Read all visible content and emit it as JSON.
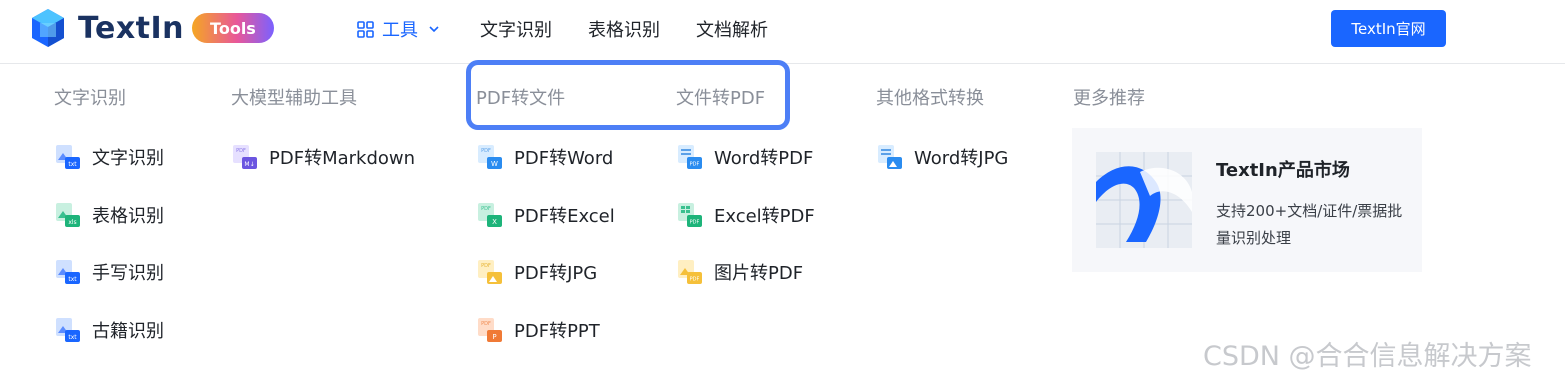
{
  "brand": {
    "name": "TextIn",
    "badge": "Tools"
  },
  "nav": {
    "tools_label": "工具",
    "items": [
      "文字识别",
      "表格识别",
      "文档解析"
    ],
    "cta": "TextIn官网"
  },
  "columns": [
    {
      "title": "文字识别",
      "items": [
        "文字识别",
        "表格识别",
        "手写识别",
        "古籍识别"
      ]
    },
    {
      "title": "大模型辅助工具",
      "items": [
        "PDF转Markdown"
      ]
    },
    {
      "title": "PDF转文件",
      "items": [
        "PDF转Word",
        "PDF转Excel",
        "PDF转JPG",
        "PDF转PPT"
      ]
    },
    {
      "title": "文件转PDF",
      "items": [
        "Word转PDF",
        "Excel转PDF",
        "图片转PDF"
      ]
    },
    {
      "title": "其他格式转换",
      "items": [
        "Word转JPG"
      ]
    },
    {
      "title": "更多推荐"
    }
  ],
  "promo": {
    "title": "TextIn产品市场",
    "desc": "支持200+文档/证件/票据批量识别处理"
  },
  "watermark": "CSDN @合合信息解决方案",
  "colors": {
    "accent": "#1a66ff",
    "highlight": "#4d7ff6",
    "muted": "#8a8f99"
  }
}
